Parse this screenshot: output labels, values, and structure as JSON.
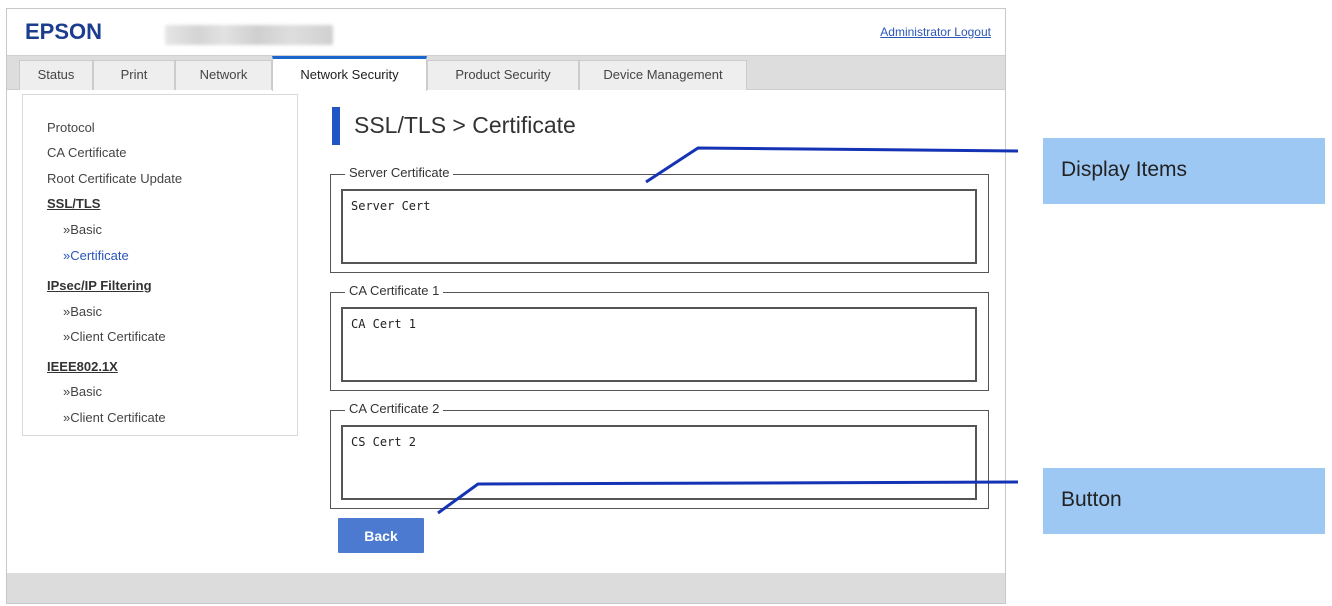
{
  "header": {
    "logo": "EPSON",
    "logout_label": "Administrator Logout"
  },
  "tabs": [
    {
      "label": "Status",
      "active": false
    },
    {
      "label": "Print",
      "active": false
    },
    {
      "label": "Network",
      "active": false
    },
    {
      "label": "Network Security",
      "active": true
    },
    {
      "label": "Product Security",
      "active": false
    },
    {
      "label": "Device Management",
      "active": false
    }
  ],
  "sidebar": {
    "items": [
      {
        "label": "Protocol",
        "type": "link"
      },
      {
        "label": "CA Certificate",
        "type": "link"
      },
      {
        "label": "Root Certificate Update",
        "type": "link"
      },
      {
        "label": "SSL/TLS",
        "type": "group"
      },
      {
        "label": "»Basic",
        "type": "sub"
      },
      {
        "label": "»Certificate",
        "type": "sub-current"
      },
      {
        "label": "IPsec/IP Filtering",
        "type": "group"
      },
      {
        "label": "»Basic",
        "type": "sub"
      },
      {
        "label": "»Client Certificate",
        "type": "sub"
      },
      {
        "label": "IEEE802.1X",
        "type": "group"
      },
      {
        "label": "»Basic",
        "type": "sub"
      },
      {
        "label": "»Client Certificate",
        "type": "sub"
      }
    ]
  },
  "main": {
    "title": "SSL/TLS > Certificate",
    "sections": [
      {
        "legend": "Server Certificate",
        "value": "Server Cert"
      },
      {
        "legend": "CA Certificate 1",
        "value": "CA Cert 1"
      },
      {
        "legend": "CA Certificate 2",
        "value": "CS Cert 2"
      }
    ],
    "back_label": "Back"
  },
  "annotations": [
    {
      "label": "Display Items"
    },
    {
      "label": "Button"
    }
  ],
  "colors": {
    "brand": "#1b3c8f",
    "accent": "#1f56c4",
    "button": "#4b7ad0",
    "callout": "#9ec8f4",
    "callout_line": "#1433b5"
  }
}
